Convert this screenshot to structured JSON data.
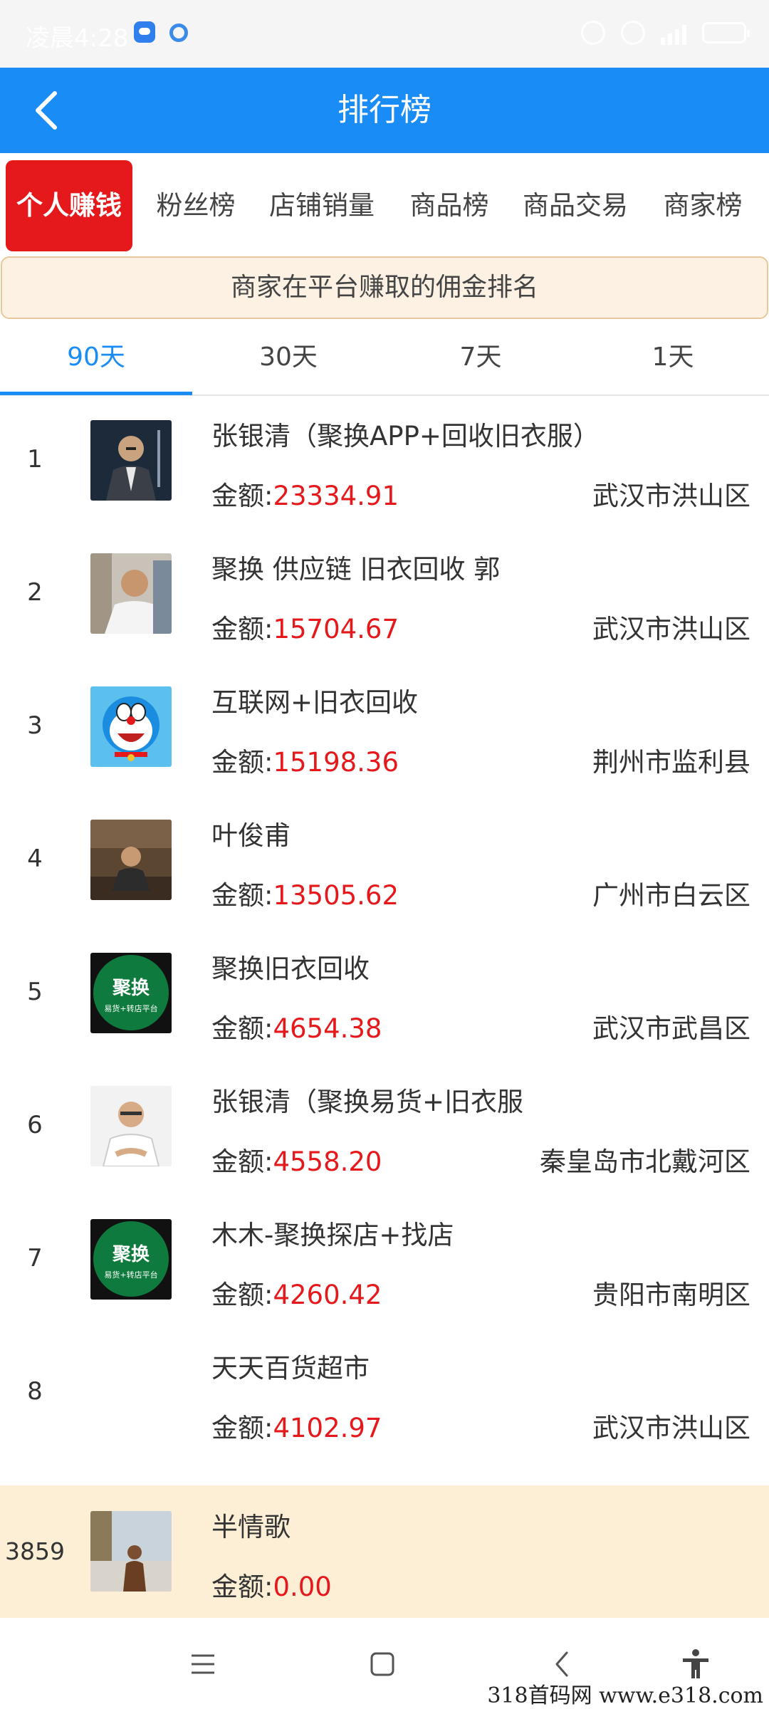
{
  "status_bar": {
    "time": "凌晨4:28"
  },
  "header": {
    "title": "排行榜"
  },
  "category_tabs": [
    {
      "label": "个人赚钱",
      "active": true
    },
    {
      "label": "粉丝榜"
    },
    {
      "label": "店铺销量"
    },
    {
      "label": "商品榜"
    },
    {
      "label": "商品交易"
    },
    {
      "label": "商家榜"
    }
  ],
  "banner": {
    "text": "商家在平台赚取的佣金排名"
  },
  "period_tabs": [
    {
      "label": "90天",
      "active": true
    },
    {
      "label": "30天"
    },
    {
      "label": "7天"
    },
    {
      "label": "1天"
    }
  ],
  "amount_label": "金额:",
  "ranking": [
    {
      "rank": "1",
      "name": "张银清（聚换APP+回收旧衣服）",
      "amount": "23334.91",
      "location": "武汉市洪山区"
    },
    {
      "rank": "2",
      "name": "聚换 供应链 旧衣回收 郭",
      "amount": "15704.67",
      "location": "武汉市洪山区"
    },
    {
      "rank": "3",
      "name": "互联网+旧衣回收",
      "amount": "15198.36",
      "location": "荆州市监利县"
    },
    {
      "rank": "4",
      "name": "叶俊甫",
      "amount": "13505.62",
      "location": "广州市白云区"
    },
    {
      "rank": "5",
      "name": "聚换旧衣回收",
      "amount": "4654.38",
      "location": "武汉市武昌区"
    },
    {
      "rank": "6",
      "name": "张银清（聚换易货+旧衣服",
      "amount": "4558.20",
      "location": "秦皇岛市北戴河区"
    },
    {
      "rank": "7",
      "name": "木木-聚换探店+找店",
      "amount": "4260.42",
      "location": "贵阳市南明区"
    },
    {
      "rank": "8",
      "name": "天天百货超市",
      "amount": "4102.97",
      "location": "武汉市洪山区"
    }
  ],
  "my_rank": {
    "rank": "3859",
    "name": "半情歌",
    "amount": "0.00"
  },
  "logo_badge": {
    "title": "聚换",
    "subtitle": "易货+转店平台"
  },
  "watermark": "318首码网  www.e318.com",
  "colors": {
    "primary": "#1a8cf5",
    "accent_red": "#e5181b",
    "banner_bg": "#fdf1e3",
    "my_rank_bg": "#fdeed6"
  }
}
